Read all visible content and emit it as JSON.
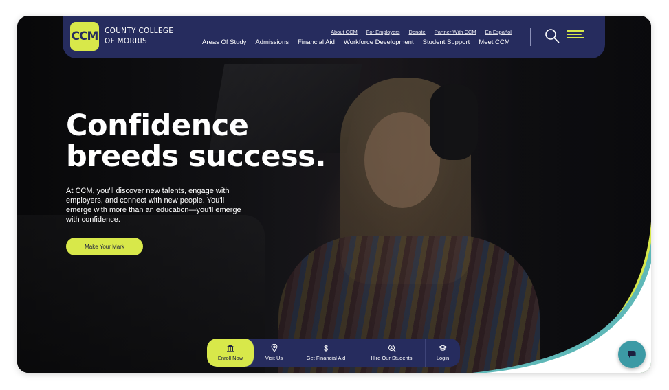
{
  "brand": {
    "logo_mark": "CCM",
    "logo_line1": "County College",
    "logo_line2": "of Morris",
    "colors": {
      "navy": "#262c5e",
      "lime": "#d8e84a",
      "teal": "#5fb8b8"
    }
  },
  "nav": {
    "utility_links": [
      "About CCM",
      "For Employers",
      "Donate",
      "Partner With CCM",
      "En Español"
    ],
    "main_links": [
      "Areas Of Study",
      "Admissions",
      "Financial Aid",
      "Workforce Development",
      "Student Support",
      "Meet CCM"
    ],
    "search_icon": "search-icon",
    "menu_icon": "hamburger-menu-icon"
  },
  "hero": {
    "headline_line1": "Confidence",
    "headline_line2": "breeds success.",
    "intro": "At CCM, you'll discover new talents, engage with employers, and connect with new people. You'll emerge with more than an education—you'll emerge with confidence.",
    "cta_label": "Make Your Mark"
  },
  "bottom_bar": {
    "items": [
      {
        "label": "Enroll Now",
        "icon": "building-icon",
        "active": true
      },
      {
        "label": "Visit Us",
        "icon": "map-pin-icon"
      },
      {
        "label": "Get Financial Aid",
        "icon": "dollar-icon"
      },
      {
        "label": "Hire Our Students",
        "icon": "search-person-icon"
      },
      {
        "label": "Login",
        "icon": "graduation-cap-icon"
      }
    ]
  },
  "chat": {
    "icon": "chat-icon"
  }
}
